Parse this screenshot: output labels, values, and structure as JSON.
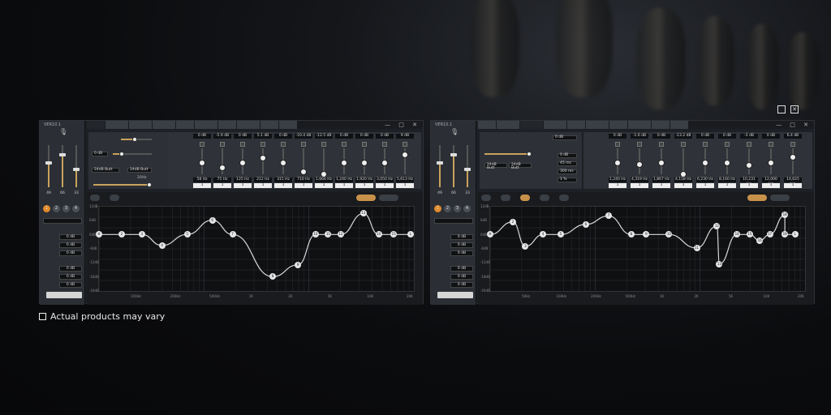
{
  "header_icons": {
    "square": "square-icon",
    "close": "close-icon",
    "close_glyph": "✕"
  },
  "note": {
    "text": "Actual products may vary",
    "icon": "checkbox-square-icon"
  },
  "colors": {
    "accent": "#e08a2a",
    "gold": "#c9a25c",
    "panel": "#2b2f35",
    "graph_bg": "#0f1012"
  },
  "left_panel": {
    "version": "VER10.1",
    "faders": [
      {
        "value": "49"
      },
      {
        "value": "66"
      },
      {
        "value": "33"
      }
    ],
    "presets": [
      "1",
      "2",
      "3",
      "4"
    ],
    "rows": [
      {
        "value": "0 dB"
      },
      {
        "value": "0 dB"
      },
      {
        "value": "0 dB"
      },
      {
        "value": "0 dB"
      },
      {
        "value": "0 dB"
      },
      {
        "value": "0 dB"
      }
    ]
  },
  "win1": {
    "window_controls": "— □ ✕",
    "crossover": {
      "slope_a": "24dB Butt",
      "slope_b": "24dB Butt",
      "gain": "0 dB",
      "range": "20Hz"
    },
    "bands": [
      {
        "gain": "0 dB",
        "freq": "58 Hz",
        "q": "1"
      },
      {
        "gain": "-5.9 dB",
        "freq": "75 Hz",
        "q": "1"
      },
      {
        "gain": "0 dB",
        "freq": "125 Hz",
        "q": "1"
      },
      {
        "gain": "5.1 dB",
        "freq": "212 Hz",
        "q": "1"
      },
      {
        "gain": "0 dB",
        "freq": "315 Hz",
        "q": "1"
      },
      {
        "gain": "-10.4 dB",
        "freq": "710 Hz",
        "q": "1"
      },
      {
        "gain": "-12.5 dB",
        "freq": "1,666 Hz",
        "q": "1"
      },
      {
        "gain": "0 dB",
        "freq": "1,240 Hz",
        "q": "1"
      },
      {
        "gain": "0 dB",
        "freq": "1,920 Hz",
        "q": "1"
      },
      {
        "gain": "0 dB",
        "freq": "3,050 Hz",
        "q": "1"
      },
      {
        "gain": "9 dB",
        "freq": "5,613 Hz",
        "q": "1"
      }
    ],
    "y_labels": [
      "12dB",
      "6dB",
      "0dB",
      "-6dB",
      "-12dB",
      "-18dB",
      "-24dB"
    ],
    "x_labels": [
      "100Hz",
      "200Hz",
      "500Hz",
      "1K",
      "2K",
      "5K",
      "10K",
      "20K"
    ],
    "points": [
      {
        "n": "H",
        "x": 0.0,
        "y": 0.33
      },
      {
        "n": "2",
        "x": 0.09,
        "y": 0.33
      },
      {
        "n": "3",
        "x": 0.17,
        "y": 0.33
      },
      {
        "n": "4",
        "x": 0.25,
        "y": 0.46
      },
      {
        "n": "5",
        "x": 0.35,
        "y": 0.33
      },
      {
        "n": "6",
        "x": 0.45,
        "y": 0.16
      },
      {
        "n": "7",
        "x": 0.53,
        "y": 0.33
      },
      {
        "n": "8",
        "x": 0.69,
        "y": 0.83
      },
      {
        "n": "9",
        "x": 0.79,
        "y": 0.69
      },
      {
        "n": "10",
        "x": 0.86,
        "y": 0.33
      },
      {
        "n": "11",
        "x": 0.91,
        "y": 0.33
      },
      {
        "n": "12",
        "x": 0.96,
        "y": 0.33
      },
      {
        "n": "13",
        "x": 1.05,
        "y": 0.08
      },
      {
        "n": "14",
        "x": 1.11,
        "y": 0.33
      },
      {
        "n": "15",
        "x": 1.17,
        "y": 0.33
      },
      {
        "n": "L",
        "x": 1.25,
        "y": 0.33
      }
    ]
  },
  "win2": {
    "window_controls": "— □ ✕",
    "delay": {
      "title": "0 dB",
      "rows": [
        {
          "value": "0 dB"
        },
        {
          "value": "45 ms"
        },
        {
          "value": "300 ms"
        },
        {
          "value": "1 %"
        }
      ]
    },
    "bands": [
      {
        "gain": "0 dB",
        "freq": "1,240 Hz",
        "q": "1"
      },
      {
        "gain": "-1.6 dB",
        "freq": "4,319 Hz",
        "q": "1"
      },
      {
        "gain": "0 dB",
        "freq": "1,867 Hz",
        "q": "1"
      },
      {
        "gain": "-13.2 dB",
        "freq": "4,158 Hz",
        "q": "1"
      },
      {
        "gain": "0 dB",
        "freq": "6,230 Hz",
        "q": "1"
      },
      {
        "gain": "0 dB",
        "freq": "8,160 Hz",
        "q": "1"
      },
      {
        "gain": "-3 dB",
        "freq": "10,231 Hz",
        "q": "1"
      },
      {
        "gain": "0 dB",
        "freq": "12,000 Hz",
        "q": "1"
      },
      {
        "gain": "6.4 dB",
        "freq": "14,625 Hz",
        "q": "1"
      }
    ],
    "y_labels": [
      "12dB",
      "6dB",
      "0dB",
      "-6dB",
      "-12dB",
      "-18dB",
      "-24dB"
    ],
    "x_labels": [
      "50Hz",
      "100Hz",
      "200Hz",
      "500Hz",
      "1K",
      "2K",
      "5K",
      "10K",
      "20K"
    ],
    "points": [
      {
        "n": "H",
        "x": 0.0,
        "y": 0.33
      },
      {
        "n": "2",
        "x": 0.09,
        "y": 0.18
      },
      {
        "n": "3",
        "x": 0.14,
        "y": 0.47
      },
      {
        "n": "4",
        "x": 0.21,
        "y": 0.33
      },
      {
        "n": "5",
        "x": 0.28,
        "y": 0.33
      },
      {
        "n": "6",
        "x": 0.38,
        "y": 0.21
      },
      {
        "n": "7",
        "x": 0.47,
        "y": 0.11
      },
      {
        "n": "8",
        "x": 0.56,
        "y": 0.33
      },
      {
        "n": "9",
        "x": 0.62,
        "y": 0.33
      },
      {
        "n": "10",
        "x": 0.71,
        "y": 0.33
      },
      {
        "n": "11",
        "x": 0.82,
        "y": 0.49
      },
      {
        "n": "12",
        "x": 0.9,
        "y": 0.23
      },
      {
        "n": "13",
        "x": 0.91,
        "y": 0.68
      },
      {
        "n": "14",
        "x": 0.98,
        "y": 0.33
      },
      {
        "n": "15",
        "x": 1.03,
        "y": 0.33
      },
      {
        "n": "16",
        "x": 1.07,
        "y": 0.4
      },
      {
        "n": "17",
        "x": 1.11,
        "y": 0.33
      },
      {
        "n": "18",
        "x": 1.17,
        "y": 0.1
      },
      {
        "n": "19",
        "x": 1.17,
        "y": 0.33
      },
      {
        "n": "L",
        "x": 1.21,
        "y": 0.33
      }
    ]
  }
}
